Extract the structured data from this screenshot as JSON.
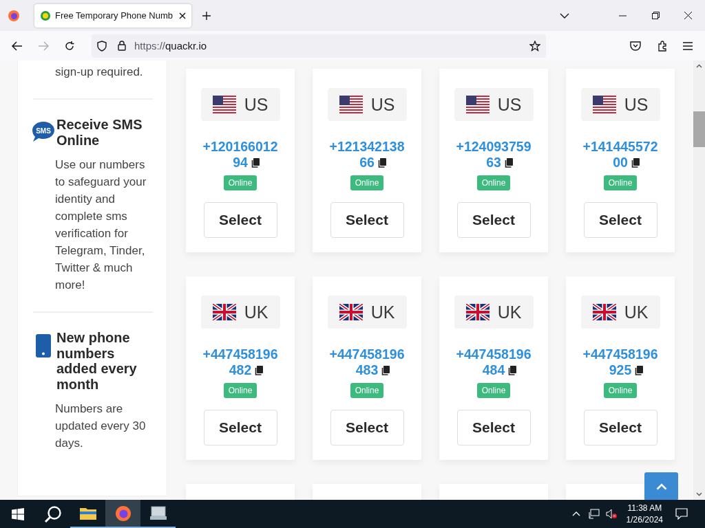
{
  "browser": {
    "tab": {
      "title": "Free Temporary Phone Numb",
      "selected": true
    },
    "url_scheme": "https://",
    "url_host": "quackr.io"
  },
  "sidebar": {
    "items": [
      {
        "kind": "text",
        "text": "sign-up required."
      },
      {
        "kind": "sms",
        "icon_label": "SMS",
        "title": "Receive SMS Online",
        "text": "Use our numbers to safeguard your identity and complete sms verification for Telegram, Tinder, Twitter & much more!"
      },
      {
        "kind": "phone",
        "title": "New phone numbers added every month",
        "text": "Numbers are updated every 30 days."
      }
    ]
  },
  "numbers": [
    {
      "kind": "us",
      "country": "US",
      "number": "+12016601294",
      "status": "Online",
      "button": "Select"
    },
    {
      "kind": "us",
      "country": "US",
      "number": "+12134213866",
      "status": "Online",
      "button": "Select"
    },
    {
      "kind": "us",
      "country": "US",
      "number": "+12409375963",
      "status": "Online",
      "button": "Select"
    },
    {
      "kind": "us",
      "country": "US",
      "number": "+14144557200",
      "status": "Online",
      "button": "Select"
    },
    {
      "kind": "uk",
      "country": "UK",
      "number": "+447458196482",
      "status": "Online",
      "button": "Select"
    },
    {
      "kind": "uk",
      "country": "UK",
      "number": "+447458196483",
      "status": "Online",
      "button": "Select"
    },
    {
      "kind": "uk",
      "country": "UK",
      "number": "+447458196484",
      "status": "Online",
      "button": "Select"
    },
    {
      "kind": "uk",
      "country": "UK",
      "number": "+447458196925",
      "status": "Online",
      "button": "Select"
    }
  ],
  "more_cards_below": true,
  "taskbar": {
    "time": "11:38 AM",
    "date": "1/26/2024"
  }
}
